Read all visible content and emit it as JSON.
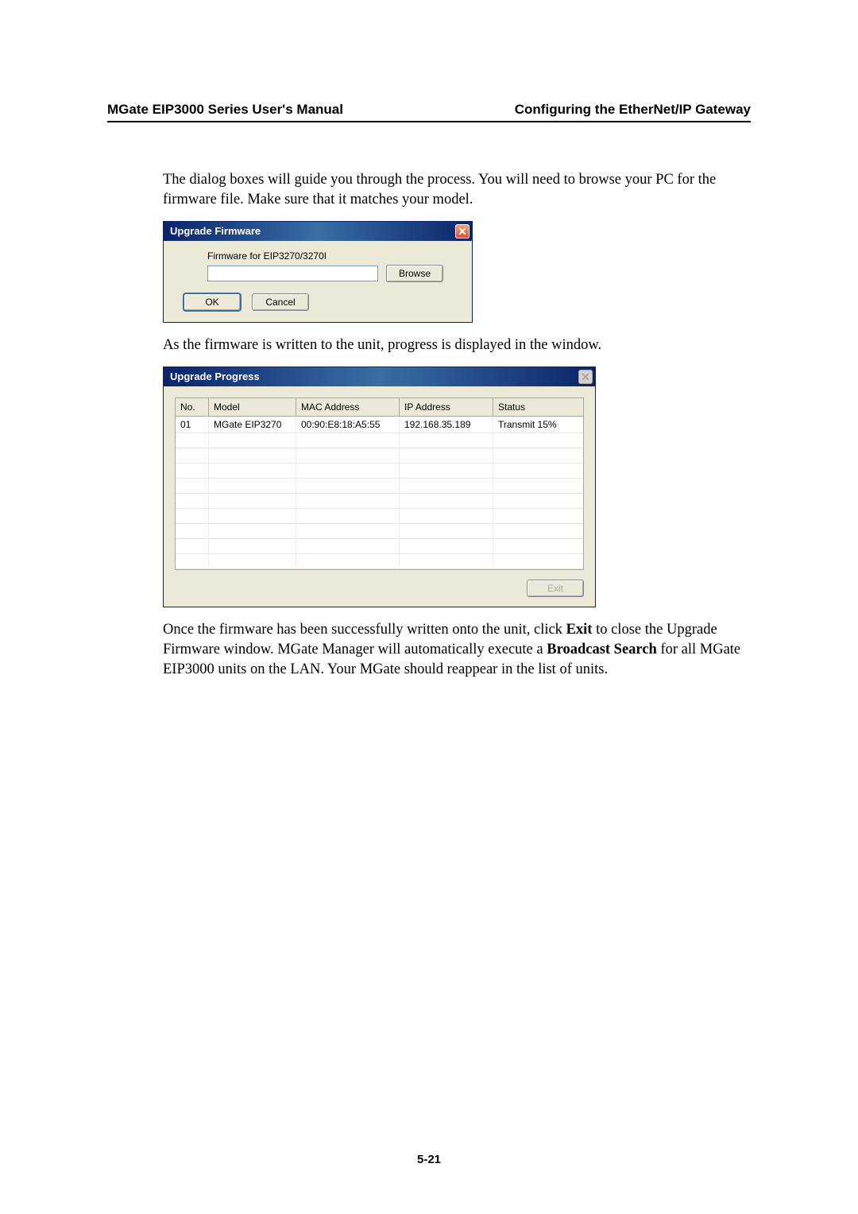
{
  "header": {
    "left": "MGate EIP3000 Series User's Manual",
    "right": "Configuring the EtherNet/IP Gateway"
  },
  "para1": "The dialog boxes will guide you through the process. You will need to browse your PC for the firmware file. Make sure that it matches your model.",
  "dialog1": {
    "title": "Upgrade Firmware",
    "close_glyph": "✕",
    "label": "Firmware for EIP3270/3270I",
    "browse": "Browse",
    "ok": "OK",
    "cancel": "Cancel"
  },
  "para2": "As the firmware is written to the unit, progress is displayed in the window.",
  "dialog2": {
    "title": "Upgrade Progress",
    "close_glyph": "✕",
    "columns": {
      "no": "No.",
      "model": "Model",
      "mac": "MAC Address",
      "ip": "IP Address",
      "status": "Status"
    },
    "rows": [
      {
        "no": "01",
        "model": "MGate EIP3270",
        "mac": "00:90:E8:18:A5:55",
        "ip": "192.168.35.189",
        "status": "Transmit 15%"
      }
    ],
    "exit": "Exit"
  },
  "para3": {
    "t1": "Once the firmware has been successfully written onto the unit, click ",
    "b1": "Exit",
    "t2": " to close the Upgrade Firmware window. MGate Manager will automatically execute a ",
    "b2": "Broadcast Search",
    "t3": " for all MGate EIP3000 units on the LAN. Your MGate should reappear in the list of units."
  },
  "page_number": "5-21"
}
